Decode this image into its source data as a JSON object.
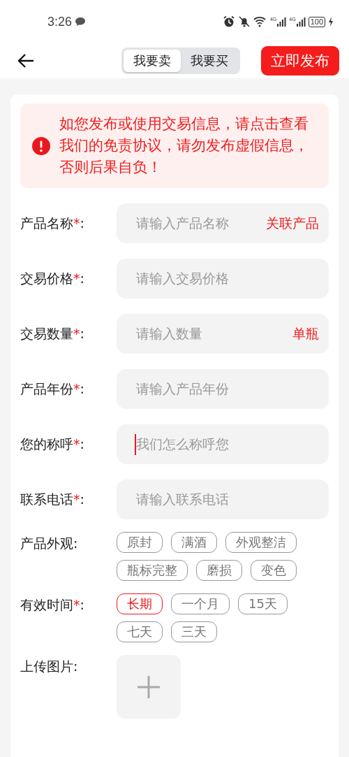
{
  "status_bar": {
    "time": "3:26",
    "network_1": "4G",
    "network_2": "4G",
    "battery": "100"
  },
  "header": {
    "tabs": [
      {
        "label": "我要卖",
        "selected": true
      },
      {
        "label": "我要买",
        "selected": false
      }
    ],
    "publish_button": "立即发布"
  },
  "notice": "如您发布或使用交易信息，请点击查看我们的免责协议，请勿发布虚假信息，否则后果自负！",
  "fields": [
    {
      "label": "产品名称",
      "required_mark": "*",
      "colon": ":",
      "placeholder": "请输入产品名称",
      "suffix": "关联产品",
      "focused": false
    },
    {
      "label": "交易价格",
      "required_mark": "*",
      "colon": ":",
      "placeholder": "请输入交易价格",
      "focused": false
    },
    {
      "label": "交易数量",
      "required_mark": "*",
      "colon": ":",
      "placeholder": "请输入数量",
      "suffix": "单瓶",
      "focused": false
    },
    {
      "label": "产品年份",
      "required_mark": "*",
      "colon": ":",
      "placeholder": "请输入产品年份",
      "focused": false
    },
    {
      "label": "您的称呼",
      "required_mark": "*",
      "colon": ":",
      "placeholder": "我们怎么称呼您",
      "focused": true
    },
    {
      "label": "联系电话",
      "required_mark": "*",
      "colon": ":",
      "placeholder": "请输入联系电话",
      "focused": false
    }
  ],
  "chip_groups": [
    {
      "label": "产品外观",
      "colon": ":",
      "options": [
        {
          "label": "原封",
          "selected": false
        },
        {
          "label": "满酒",
          "selected": false
        },
        {
          "label": "外观整洁",
          "selected": false
        },
        {
          "label": "瓶标完整",
          "selected": false
        },
        {
          "label": "磨损",
          "selected": false
        },
        {
          "label": "变色",
          "selected": false
        }
      ]
    },
    {
      "label": "有效时间",
      "required_mark": "*",
      "colon": ":",
      "options": [
        {
          "label": "长期",
          "selected": true
        },
        {
          "label": "一个月",
          "selected": false
        },
        {
          "label": "15天",
          "selected": false
        },
        {
          "label": "七天",
          "selected": false
        },
        {
          "label": "三天",
          "selected": false
        }
      ]
    }
  ],
  "upload": {
    "label": "上传图片:"
  }
}
